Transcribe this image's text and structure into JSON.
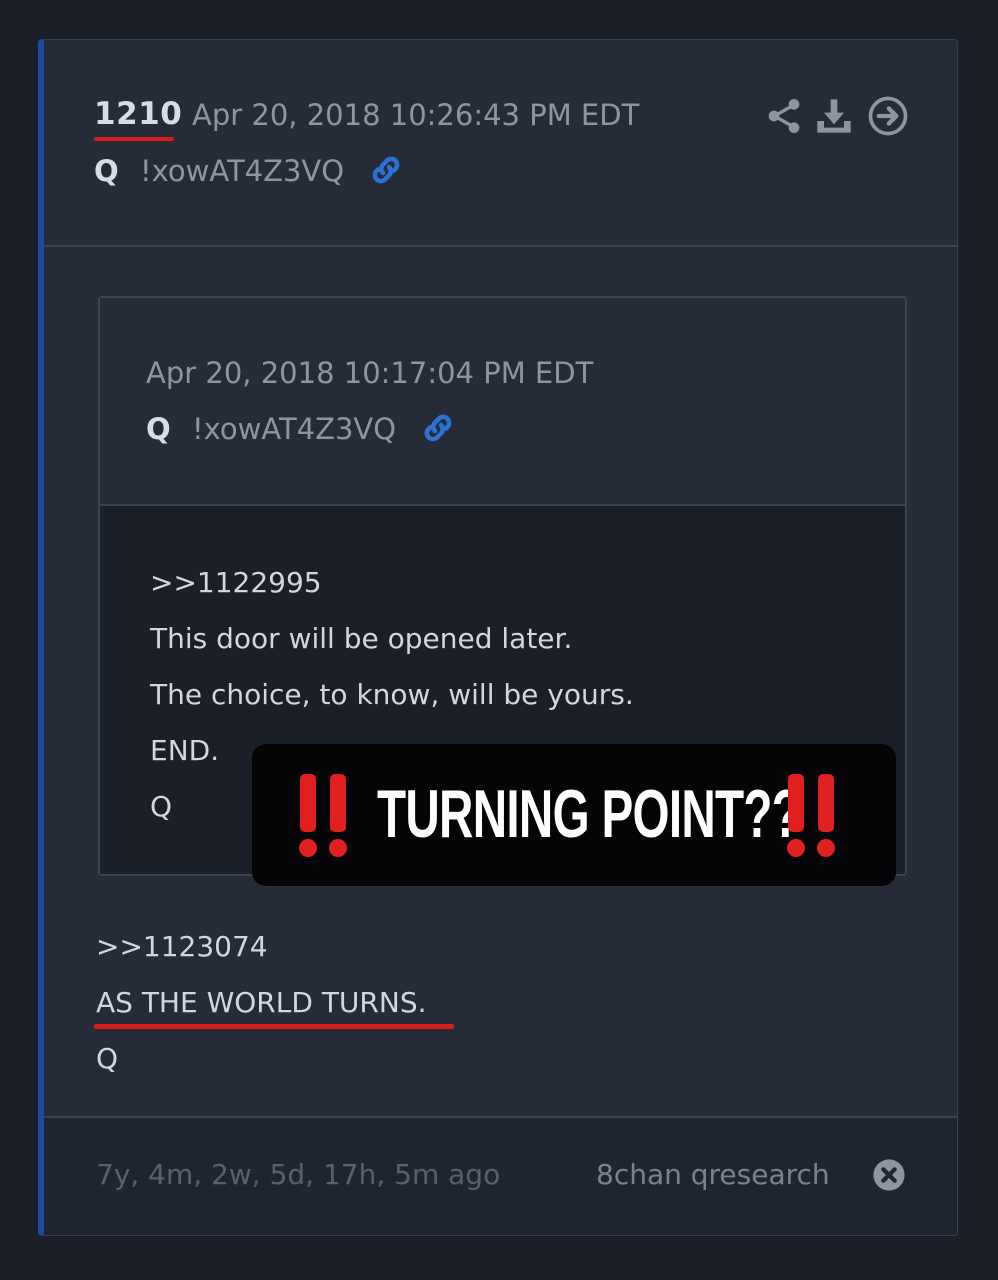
{
  "post": {
    "number": "1210",
    "date": "Apr 20, 2018 10:26:43 PM EDT",
    "author": "Q",
    "tripcode": "!xowAT4Z3VQ",
    "icons": [
      "share-icon",
      "download-icon",
      "arrow-right-circle-icon",
      "link-icon"
    ]
  },
  "quoted": {
    "date": "Apr 20, 2018 10:17:04 PM EDT",
    "author": "Q",
    "tripcode": "!xowAT4Z3VQ",
    "lines": [
      ">>1122995",
      "This door will be opened later.",
      "The choice, to know, will be yours.",
      "END.",
      "Q"
    ]
  },
  "body": {
    "lines": [
      ">>1123074",
      "AS THE WORLD TURNS.",
      "Q"
    ]
  },
  "footer": {
    "age": "7y, 4m, 2w, 5d, 17h, 5m ago",
    "source": "8chan qresearch"
  },
  "overlay": {
    "text": "TURNING POINT??",
    "emoji": "‼️"
  },
  "colors": {
    "accent_bar": "#1b4a9e",
    "link_blue": "#2a73d4",
    "underline_red": "#d81c1c",
    "emoji_red": "#e0201e"
  }
}
